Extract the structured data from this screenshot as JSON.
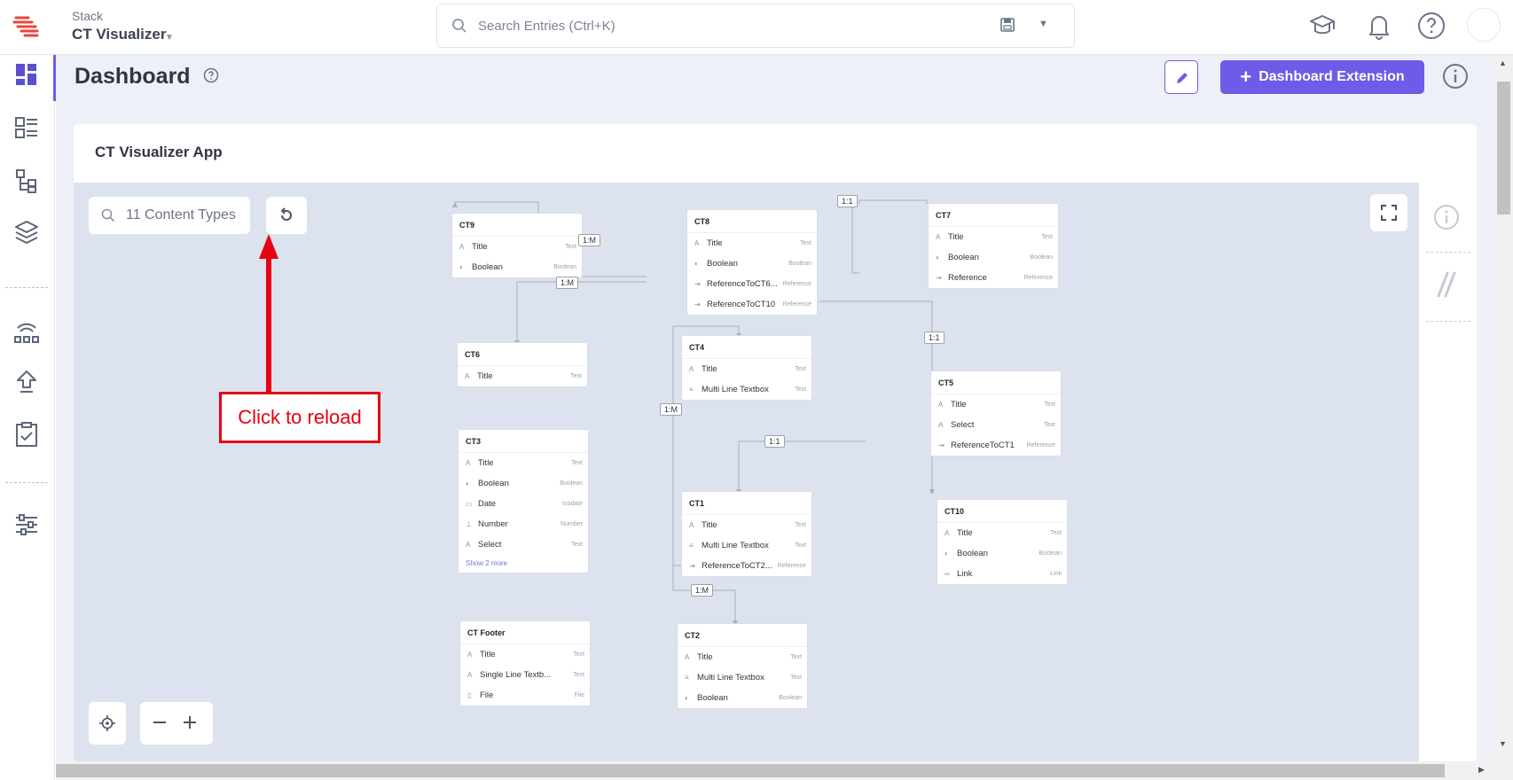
{
  "header": {
    "stack_label": "Stack",
    "stack_name": "CT Visualizer",
    "search_placeholder": "Search Entries (Ctrl+K)",
    "icons": [
      "academy-icon",
      "bell-icon",
      "help-icon"
    ]
  },
  "sidebar": {
    "items": [
      "dashboard",
      "entries",
      "content-models",
      "assets",
      "releases",
      "publish-queue",
      "tasks",
      "settings"
    ],
    "active": "dashboard"
  },
  "page": {
    "title": "Dashboard",
    "extension_button": "Dashboard Extension"
  },
  "app": {
    "title": "CT Visualizer App",
    "ct_search_text": "11 Content Types",
    "annotation": "Click to reload"
  },
  "nodes": {
    "ct9": {
      "title": "CT9",
      "fields": [
        {
          "name": "Title",
          "type": "Text",
          "icon": "A"
        },
        {
          "name": "Boolean",
          "type": "Boolean",
          "icon": "◐"
        }
      ]
    },
    "ct8": {
      "title": "CT8",
      "fields": [
        {
          "name": "Title",
          "type": "Text",
          "icon": "A"
        },
        {
          "name": "Boolean",
          "type": "Boolean",
          "icon": "◐"
        },
        {
          "name": "ReferenceToCT6...",
          "type": "Reference",
          "icon": "⇥"
        },
        {
          "name": "ReferenceToCT10",
          "type": "Reference",
          "icon": "⇥"
        }
      ]
    },
    "ct7": {
      "title": "CT7",
      "fields": [
        {
          "name": "Title",
          "type": "Text",
          "icon": "A"
        },
        {
          "name": "Boolean",
          "type": "Boolean",
          "icon": "◐"
        },
        {
          "name": "Reference",
          "type": "Reference",
          "icon": "⇥"
        }
      ]
    },
    "ct6": {
      "title": "CT6",
      "fields": [
        {
          "name": "Title",
          "type": "Text",
          "icon": "A"
        }
      ]
    },
    "ct4": {
      "title": "CT4",
      "fields": [
        {
          "name": "Title",
          "type": "Text",
          "icon": "A"
        },
        {
          "name": "Multi Line Textbox",
          "type": "Text",
          "icon": "≡"
        }
      ]
    },
    "ct5": {
      "title": "CT5",
      "fields": [
        {
          "name": "Title",
          "type": "Text",
          "icon": "A"
        },
        {
          "name": "Select",
          "type": "Text",
          "icon": "A"
        },
        {
          "name": "ReferenceToCT1",
          "type": "Reference",
          "icon": "⇥"
        }
      ]
    },
    "ct3": {
      "title": "CT3",
      "fields": [
        {
          "name": "Title",
          "type": "Text",
          "icon": "A"
        },
        {
          "name": "Boolean",
          "type": "Boolean",
          "icon": "◐"
        },
        {
          "name": "Date",
          "type": "Isodate",
          "icon": "▭"
        },
        {
          "name": "Number",
          "type": "Number",
          "icon": "⊥"
        },
        {
          "name": "Select",
          "type": "Text",
          "icon": "A"
        }
      ],
      "show_more": "Show 2 more"
    },
    "ct1": {
      "title": "CT1",
      "fields": [
        {
          "name": "Title",
          "type": "Text",
          "icon": "A"
        },
        {
          "name": "Multi Line Textbox",
          "type": "Text",
          "icon": "≡"
        },
        {
          "name": "ReferenceToCT2...",
          "type": "Reference",
          "icon": "⇥"
        }
      ]
    },
    "ct10": {
      "title": "CT10",
      "fields": [
        {
          "name": "Title",
          "type": "Text",
          "icon": "A"
        },
        {
          "name": "Boolean",
          "type": "Boolean",
          "icon": "◐"
        },
        {
          "name": "Link",
          "type": "Link",
          "icon": "∞"
        }
      ]
    },
    "ctfooter": {
      "title": "CT Footer",
      "fields": [
        {
          "name": "Title",
          "type": "Text",
          "icon": "A"
        },
        {
          "name": "Single Line Textb...",
          "type": "Text",
          "icon": "A"
        },
        {
          "name": "File",
          "type": "File",
          "icon": "▯"
        }
      ]
    },
    "ct2": {
      "title": "CT2",
      "fields": [
        {
          "name": "Title",
          "type": "Text",
          "icon": "A"
        },
        {
          "name": "Multi Line Textbox",
          "type": "Text",
          "icon": "≡"
        },
        {
          "name": "Boolean",
          "type": "Boolean",
          "icon": "◐"
        }
      ]
    }
  },
  "relations": {
    "r1": "1:M",
    "r2": "1:M",
    "r3": "1:1",
    "r4": "1:1",
    "r5": "1:M",
    "r6": "1:1",
    "r7": "1:M"
  },
  "colors": {
    "accent": "#6c5ce7",
    "annotation": "#e60012",
    "canvas": "#dde3ee"
  }
}
